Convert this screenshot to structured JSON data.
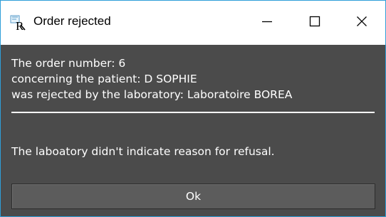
{
  "window": {
    "title": "Order rejected",
    "app_icon": "rx-icon",
    "controls": {
      "minimize_icon": "minimize-icon",
      "maximize_icon": "maximize-icon",
      "close_icon": "close-icon"
    }
  },
  "message": {
    "order_line": "The order number: 6",
    "patient_line": "concerning the patient: D SOPHIE",
    "lab_line": "was rejected by the laboratory: Laboratoire BOREA",
    "reason": "The laboatory didn't indicate reason for refusal."
  },
  "actions": {
    "ok_label": "Ok"
  },
  "colors": {
    "accent_border": "#2f9fd9",
    "dialog_background": "#4b4b4b",
    "button_background": "#5c5c5c",
    "text": "#ffffff"
  }
}
